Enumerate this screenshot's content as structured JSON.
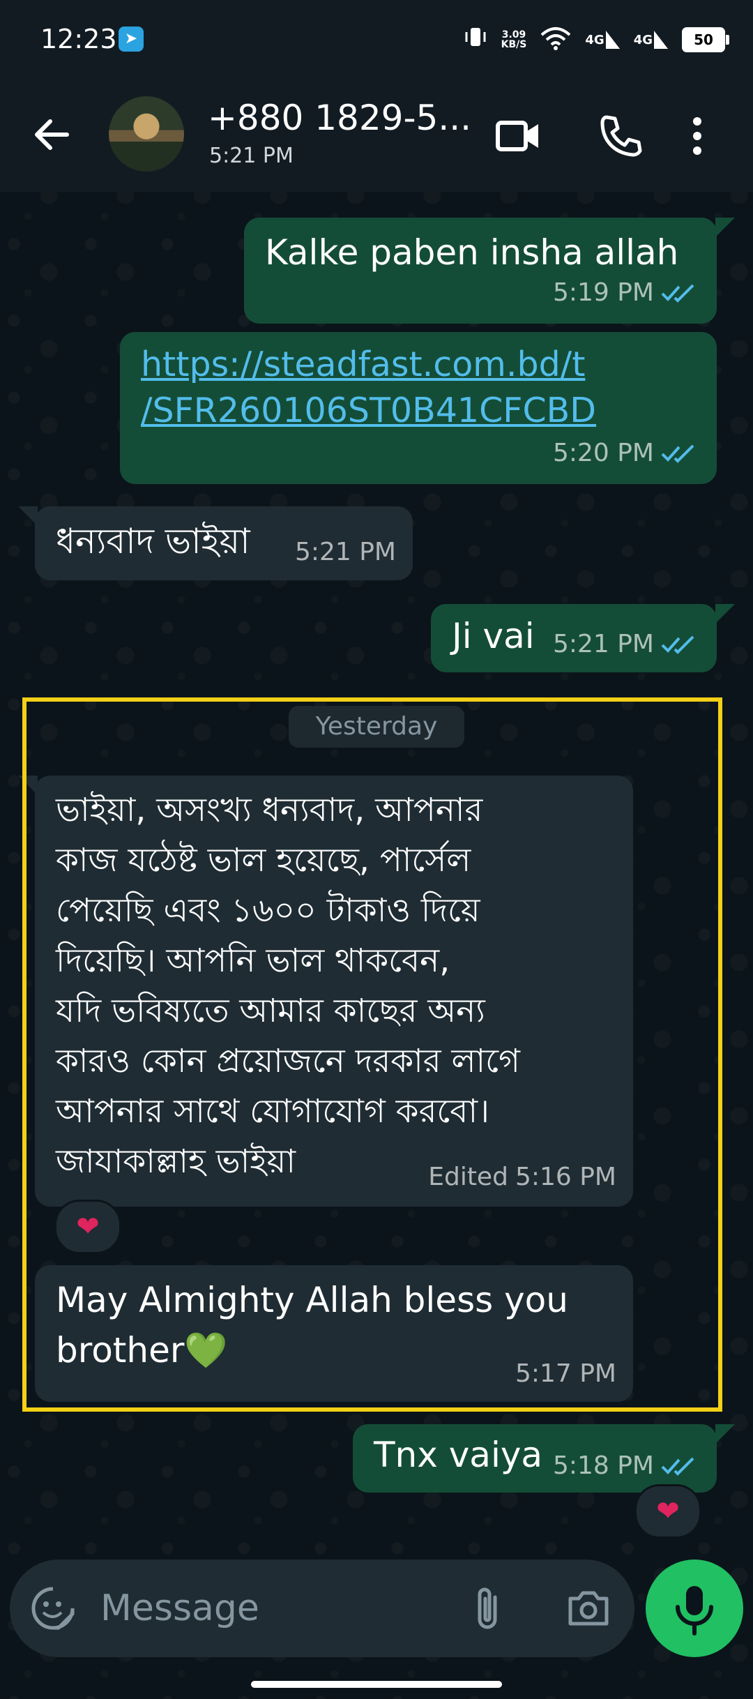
{
  "status_bar": {
    "time": "12:23",
    "net_speed_value": "3.09",
    "net_speed_unit": "KB/S",
    "sig1": "4G",
    "sig2": "4G",
    "battery": "50"
  },
  "header": {
    "contact_name": "+880 1829-5...",
    "last_seen": "5:21 PM"
  },
  "messages": [
    {
      "text": "Kalke paben insha allah",
      "time": "5:19 PM"
    },
    {
      "text_line1": "https://steadfast.com.bd/t",
      "text_line2": "/SFR260106ST0B41CFCBD",
      "time": "5:20 PM"
    },
    {
      "text": "ধন্যবাদ ভাইয়া",
      "time": "5:21 PM"
    },
    {
      "text": "Ji vai",
      "time": "5:21 PM"
    },
    {
      "lines": [
        "ভাইয়া, অসংখ্য ধন্যবাদ, আপনার",
        "কাজ যঠেষ্ট ভাল হয়েছে, পার্সেল",
        "পেয়েছি এবং ১৬০০ টাকাও দিয়ে",
        "দিয়েছি। আপনি ভাল থাকবেন,",
        "যদি ভবিষ্যতে আমার কাছের অন্য",
        "কারও কোন প্রয়োজনে দরকার লাগে",
        "আপনার সাথে যোগাযোগ করবো।",
        "জাযাকাল্লাহ ভাইয়া"
      ],
      "edited": "Edited",
      "time": "5:16 PM",
      "reaction": "❤"
    },
    {
      "line1": "May Almighty Allah bless you",
      "line2": "brother",
      "emoji": "💚",
      "time": "5:17 PM"
    },
    {
      "text": "Tnx vaiya",
      "time": "5:18 PM",
      "reaction": "❤"
    }
  ],
  "date_divider": "Yesterday",
  "input": {
    "placeholder": "Message"
  },
  "colors": {
    "background": "#0b141a",
    "outgoing_bubble": "#144d37",
    "incoming_bubble": "#1f2c33",
    "read_ticks": "#53bdeb",
    "highlight_border": "#f5d016",
    "mic_button": "#21c063"
  }
}
